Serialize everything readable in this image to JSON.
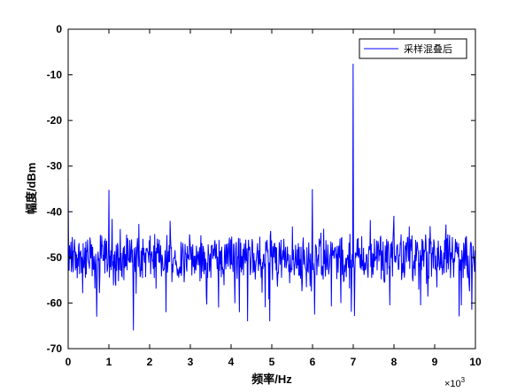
{
  "chart_data": {
    "type": "line",
    "title": "",
    "xlabel": "频率/Hz",
    "ylabel": "幅度/dBm",
    "x_exponent_label": "×10",
    "x_exponent": "3",
    "xlim": [
      0,
      10000
    ],
    "ylim": [
      -70,
      0
    ],
    "xticks": [
      0,
      1,
      2,
      3,
      4,
      5,
      6,
      7,
      8,
      9,
      10
    ],
    "xtick_labels": [
      "0",
      "1",
      "2",
      "3",
      "4",
      "5",
      "6",
      "7",
      "8",
      "9",
      "10"
    ],
    "yticks": [
      0,
      -10,
      -20,
      -30,
      -40,
      -50,
      -60,
      -70
    ],
    "ytick_labels": [
      "0",
      "-10",
      "-20",
      "-30",
      "-40",
      "-50",
      "-60",
      "-70"
    ],
    "grid": false,
    "legend": {
      "position": "top-right",
      "entries": [
        "采样混叠后"
      ]
    },
    "series": [
      {
        "name": "采样混叠后",
        "color": "#0000ff",
        "noise_floor_db": -50,
        "peaks": [
          {
            "x": 0,
            "y": -33
          },
          {
            "x": 1000,
            "y": -35.3
          },
          {
            "x": 6000,
            "y": -35.2
          },
          {
            "x": 7000,
            "y": -7.7
          },
          {
            "x": 8000,
            "y": -41
          }
        ],
        "dips": [
          {
            "x": 700,
            "y": -63
          },
          {
            "x": 1600,
            "y": -66
          },
          {
            "x": 2400,
            "y": -62
          },
          {
            "x": 4200,
            "y": -62
          },
          {
            "x": 4400,
            "y": -64
          },
          {
            "x": 4950,
            "y": -64
          },
          {
            "x": 6050,
            "y": -62.5
          },
          {
            "x": 6700,
            "y": -60
          },
          {
            "x": 7900,
            "y": -60.5
          },
          {
            "x": 8650,
            "y": -60.5
          },
          {
            "x": 9650,
            "y": -60.5
          }
        ]
      }
    ]
  }
}
